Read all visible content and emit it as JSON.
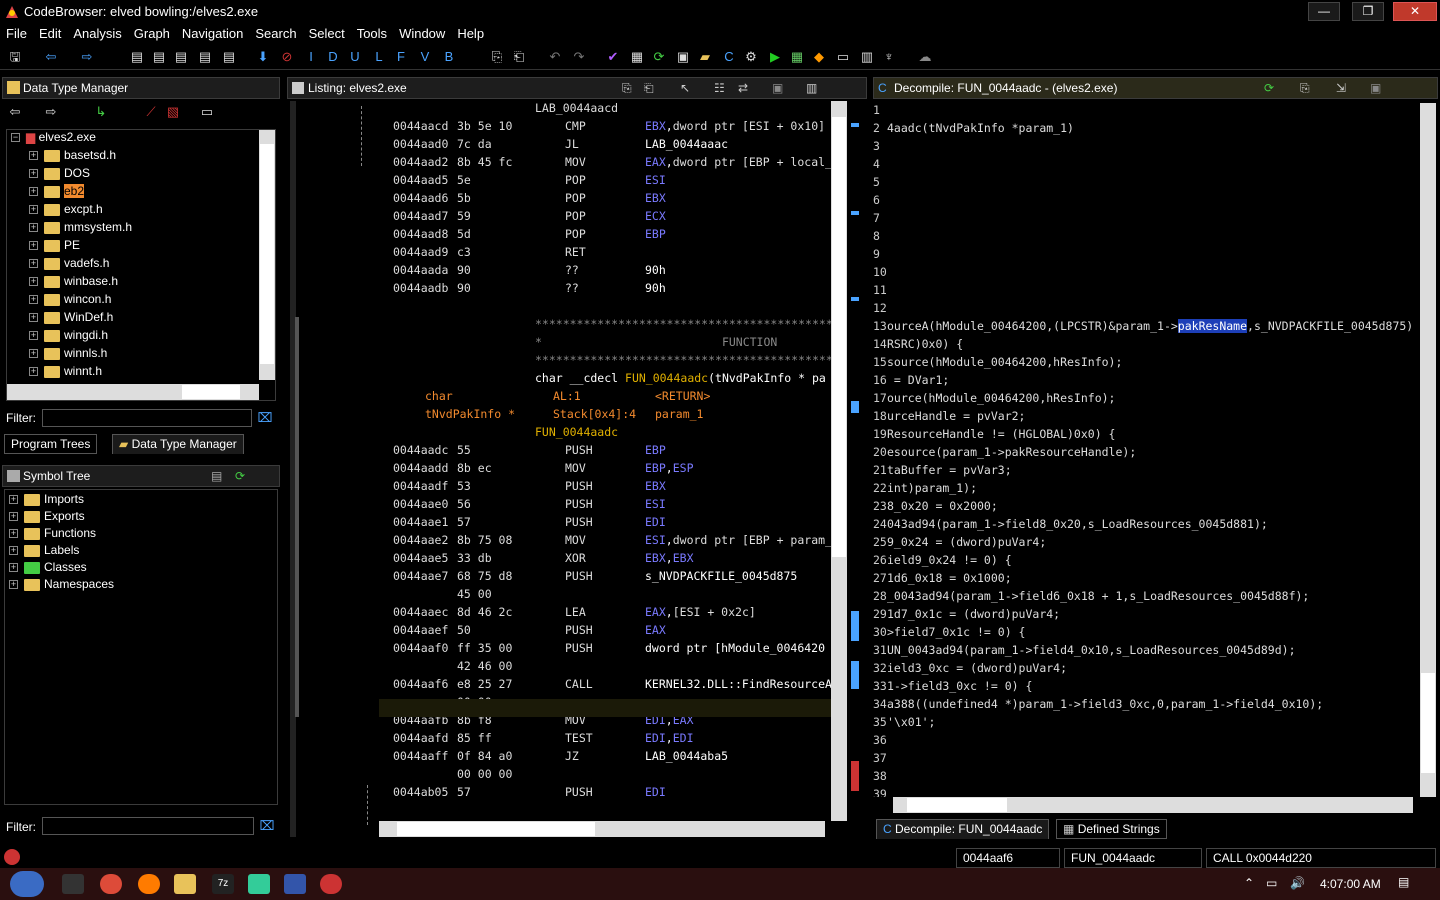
{
  "window": {
    "title": "CodeBrowser: elved bowling:/elves2.exe"
  },
  "menu": [
    "File",
    "Edit",
    "Analysis",
    "Graph",
    "Navigation",
    "Search",
    "Select",
    "Tools",
    "Window",
    "Help"
  ],
  "toolbar_letters": [
    "I",
    "D",
    "U",
    "L",
    "F",
    "V",
    "B"
  ],
  "dtm": {
    "title": "Data Type Manager",
    "root": "elves2.exe",
    "items": [
      "basetsd.h",
      "DOS",
      "eb2",
      "excpt.h",
      "mmsystem.h",
      "PE",
      "vadefs.h",
      "winbase.h",
      "wincon.h",
      "WinDef.h",
      "wingdi.h",
      "winnls.h",
      "winnt.h"
    ],
    "selected": "eb2",
    "filter_label": "Filter:"
  },
  "left_tabs": [
    "Program Trees",
    "Data Type Manager"
  ],
  "symbol_tree": {
    "title": "Symbol Tree",
    "items": [
      "Imports",
      "Exports",
      "Functions",
      "Labels",
      "Classes",
      "Namespaces"
    ],
    "filter_label": "Filter:"
  },
  "listing": {
    "title": "Listing:  elves2.exe",
    "rows": [
      {
        "label": "LAB_0044aacd"
      },
      {
        "addr": "0044aacd",
        "bytes": "3b 5e 10",
        "mnem": "CMP",
        "op": "EBX,dword ptr [ESI + 0x10]"
      },
      {
        "addr": "0044aad0",
        "bytes": "7c da",
        "mnem": "JL",
        "op": "LAB_0044aaac"
      },
      {
        "addr": "0044aad2",
        "bytes": "8b 45 fc",
        "mnem": "MOV",
        "op": "EAX,dword ptr [EBP + local_"
      },
      {
        "addr": "0044aad5",
        "bytes": "5e",
        "mnem": "POP",
        "op": "ESI"
      },
      {
        "addr": "0044aad6",
        "bytes": "5b",
        "mnem": "POP",
        "op": "EBX"
      },
      {
        "addr": "0044aad7",
        "bytes": "59",
        "mnem": "POP",
        "op": "ECX"
      },
      {
        "addr": "0044aad8",
        "bytes": "5d",
        "mnem": "POP",
        "op": "EBP"
      },
      {
        "addr": "0044aad9",
        "bytes": "c3",
        "mnem": "RET",
        "op": ""
      },
      {
        "addr": "0044aada",
        "bytes": "90",
        "mnem": "??",
        "op": "90h"
      },
      {
        "addr": "0044aadb",
        "bytes": "90",
        "mnem": "??",
        "op": "90h"
      }
    ],
    "stars": "******************************************************",
    "function_banner": "FUNCTION",
    "signature": "char __cdecl FUN_0044aadc(tNvdPakInfo * pa",
    "sig_rows": [
      {
        "type": "char",
        "name": "AL:1",
        "ret": "<RETURN>"
      },
      {
        "type": "tNvdPakInfo *",
        "name": "Stack[0x4]:4",
        "ret": "param_1"
      }
    ],
    "func_label": "FUN_0044aadc",
    "rows2": [
      {
        "addr": "0044aadc",
        "bytes": "55",
        "mnem": "PUSH",
        "op": "EBP"
      },
      {
        "addr": "0044aadd",
        "bytes": "8b ec",
        "mnem": "MOV",
        "op": "EBP,ESP"
      },
      {
        "addr": "0044aadf",
        "bytes": "53",
        "mnem": "PUSH",
        "op": "EBX"
      },
      {
        "addr": "0044aae0",
        "bytes": "56",
        "mnem": "PUSH",
        "op": "ESI"
      },
      {
        "addr": "0044aae1",
        "bytes": "57",
        "mnem": "PUSH",
        "op": "EDI"
      },
      {
        "addr": "0044aae2",
        "bytes": "8b 75 08",
        "mnem": "MOV",
        "op": "ESI,dword ptr [EBP + param_"
      },
      {
        "addr": "0044aae5",
        "bytes": "33 db",
        "mnem": "XOR",
        "op": "EBX,EBX"
      },
      {
        "addr": "0044aae7",
        "bytes": "68 75 d8",
        "mnem": "PUSH",
        "op": "s_NVDPACKFILE_0045d875"
      },
      {
        "addr": "",
        "bytes": "45 00",
        "mnem": "",
        "op": ""
      },
      {
        "addr": "0044aaec",
        "bytes": "8d 46 2c",
        "mnem": "LEA",
        "op": "EAX,[ESI + 0x2c]"
      },
      {
        "addr": "0044aaef",
        "bytes": "50",
        "mnem": "PUSH",
        "op": "EAX"
      },
      {
        "addr": "0044aaf0",
        "bytes": "ff 35 00",
        "mnem": "PUSH",
        "op": "dword ptr [hModule_0046420"
      },
      {
        "addr": "",
        "bytes": "42 46 00",
        "mnem": "",
        "op": ""
      },
      {
        "addr": "0044aaf6",
        "bytes": "e8 25 27",
        "mnem": "CALL",
        "op": "KERNEL32.DLL::FindResourceA"
      },
      {
        "addr": "",
        "bytes": "00 00",
        "mnem": "",
        "op": ""
      },
      {
        "addr": "0044aafb",
        "bytes": "8b f8",
        "mnem": "MOV",
        "op": "EDI,EAX"
      },
      {
        "addr": "0044aafd",
        "bytes": "85 ff",
        "mnem": "TEST",
        "op": "EDI,EDI"
      },
      {
        "addr": "0044aaff",
        "bytes": "0f 84 a0",
        "mnem": "JZ",
        "op": "LAB_0044aba5"
      },
      {
        "addr": "",
        "bytes": "00 00 00",
        "mnem": "",
        "op": ""
      },
      {
        "addr": "0044ab05",
        "bytes": "57",
        "mnem": "PUSH",
        "op": "EDI"
      }
    ]
  },
  "decompile": {
    "title": "Decompile: FUN_0044aadc - (elves2.exe)",
    "lines": [
      "",
      "4aadc(tNvdPakInfo *param_1)",
      "",
      "",
      "",
      "",
      "",
      "",
      "",
      "",
      "",
      "",
      "ourceA(hModule_00464200,(LPCSTR)&param_1->pakResName,s_NVDPACKFILE_0045d875)",
      "RSRC)0x0) {",
      "source(hModule_00464200,hResInfo);",
      " = DVar1;",
      "ource(hModule_00464200,hResInfo);",
      "urceHandle = pvVar2;",
      "ResourceHandle != (HGLOBAL)0x0) {",
      "esource(param_1->pakResourceHandle);",
      "taBuffer = pvVar3;",
      "int)param_1);",
      "8_0x20 = 0x2000;",
      "043ad94(param_1->field8_0x20,s_LoadResources_0045d881);",
      "9_0x24 = (dword)puVar4;",
      "ield9_0x24 != 0) {",
      "1d6_0x18 = 0x1000;",
      "_0043ad94(param_1->field6_0x18 + 1,s_LoadResources_0045d88f);",
      "1d7_0x1c = (dword)puVar4;",
      ">field7_0x1c != 0) {",
      "UN_0043ad94(param_1->field4_0x10,s_LoadResources_0045d89d);",
      "ield3_0xc = (dword)puVar4;",
      "1->field3_0xc != 0) {",
      "a388((undefined4 *)param_1->field3_0xc,0,param_1->field4_0x10);",
      "'\\x01';",
      "",
      "",
      "",
      ""
    ],
    "highlight": "pakResName"
  },
  "right_tabs": [
    "Decompile: FUN_0044aadc",
    "Defined Strings"
  ],
  "status": {
    "addr": "0044aaf6",
    "func": "FUN_0044aadc",
    "instr": "CALL 0x0044d220"
  },
  "taskbar": {
    "time": "4:07:00 AM"
  }
}
